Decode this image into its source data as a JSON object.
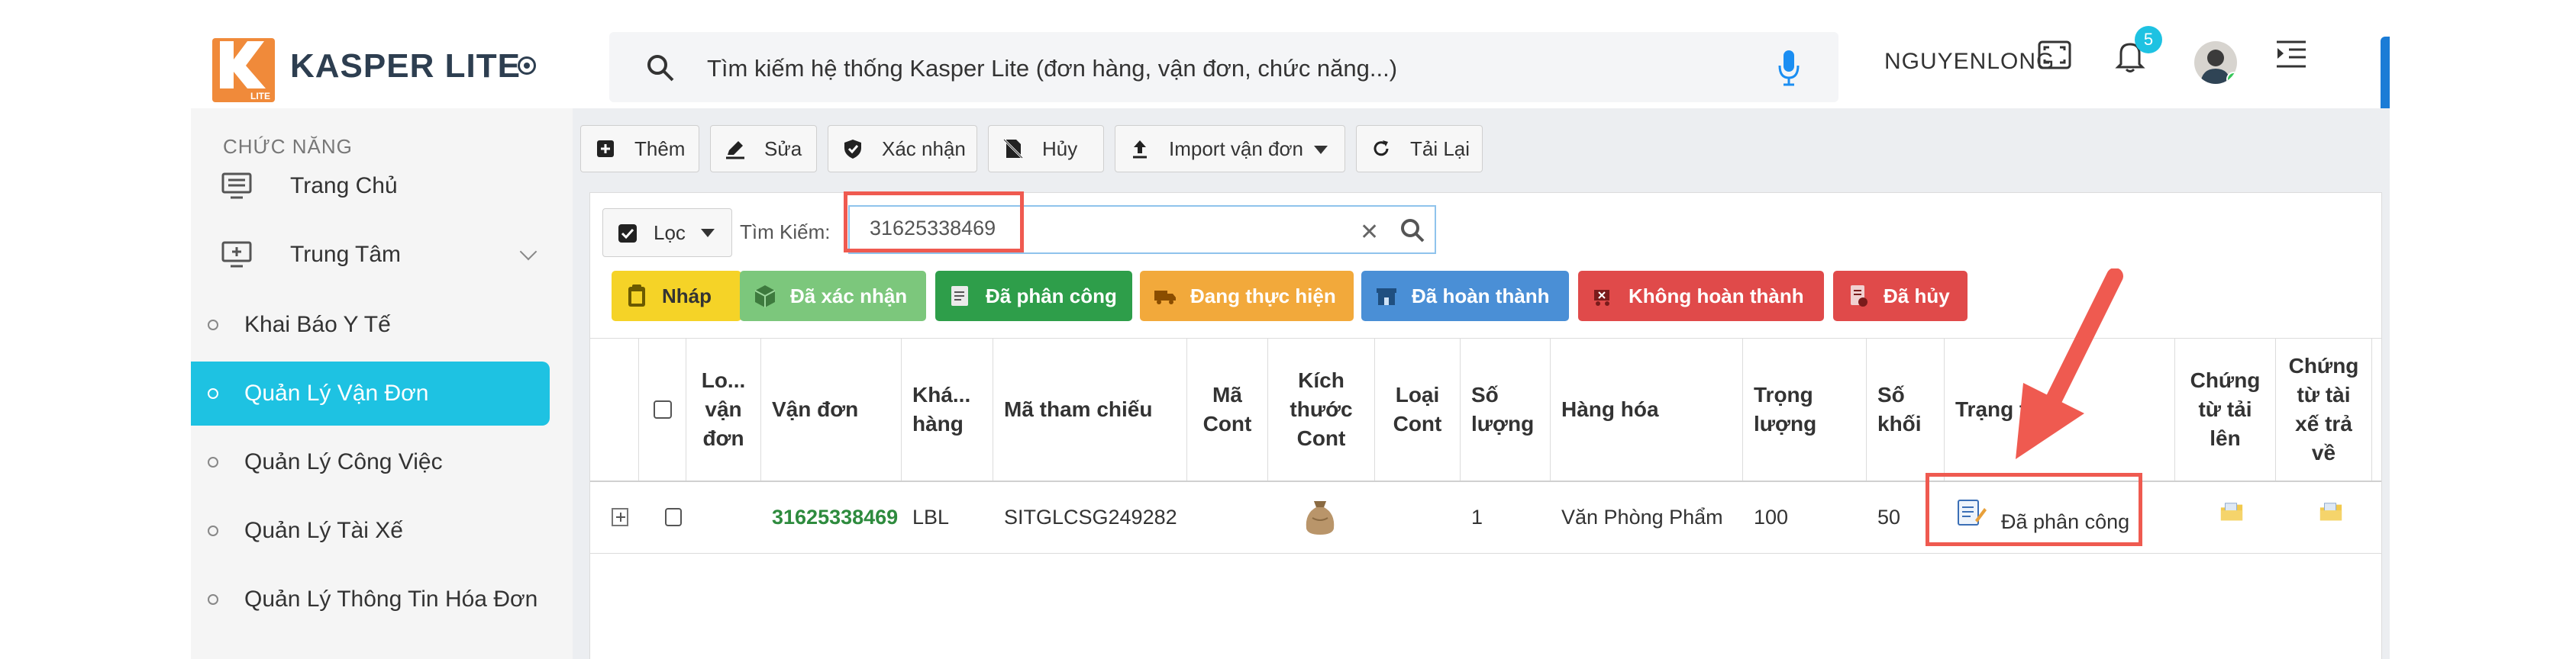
{
  "brand": {
    "name": "KASPER LITE",
    "logo_letter": "K",
    "logo_sub": "LITE"
  },
  "sidebar": {
    "section_title": "CHỨC NĂNG",
    "items": [
      {
        "label": "Trang Chủ",
        "icon": "monitor-icon"
      },
      {
        "label": "Trung Tâm",
        "icon": "add-screen-icon"
      },
      {
        "label": "Khai Báo Y Tế"
      },
      {
        "label": "Quản Lý Vận Đơn",
        "active": true
      },
      {
        "label": "Quản Lý Công Việc"
      },
      {
        "label": "Quản Lý Tài Xế"
      },
      {
        "label": "Quản Lý Thông Tin Hóa Đơn"
      }
    ]
  },
  "topbar": {
    "search_text": "Tìm kiếm hệ thống Kasper Lite (đơn hàng, vận đơn, chức năng...)",
    "username": "NGUYENLONG",
    "notification_count": "5"
  },
  "toolbar": {
    "add": "Thêm",
    "edit": "Sửa",
    "confirm": "Xác nhận",
    "cancel": "Hủy",
    "import": "Import vận đơn",
    "reload": "Tải Lại"
  },
  "filter": {
    "filter_label": "Lọc",
    "search_label": "Tìm Kiếm:",
    "search_value": "31625338469"
  },
  "status_chips": [
    {
      "label": "Nháp",
      "color": "#f5d327",
      "text_color": "#333333"
    },
    {
      "label": "Đã xác nhận",
      "color": "#7cc77c",
      "text_color": "#ffffff"
    },
    {
      "label": "Đã phân công",
      "color": "#2e9e4a",
      "text_color": "#ffffff"
    },
    {
      "label": "Đang thực hiện",
      "color": "#f2a93b",
      "text_color": "#ffffff"
    },
    {
      "label": "Đã hoàn thành",
      "color": "#4a8fd6",
      "text_color": "#ffffff"
    },
    {
      "label": "Không hoàn thành",
      "color": "#e04a4a",
      "text_color": "#ffffff"
    },
    {
      "label": "Đã hủy",
      "color": "#e04a4a",
      "text_color": "#ffffff"
    }
  ],
  "table": {
    "headers": {
      "loai_van_don": "Lo... vận đơn",
      "van_don": "Vận đơn",
      "khach_hang": "Khá... hàng",
      "ma_tham_chieu": "Mã tham chiếu",
      "ma_cont": "Mã Cont",
      "kich_thuoc": "Kích thước Cont",
      "loai_cont": "Loại Cont",
      "so_luong": "Số lượng",
      "hang_hoa": "Hàng hóa",
      "trong_luong": "Trọng lượng",
      "so_khoi": "Số khối",
      "trang_thai": "Trạng thá",
      "chung_tu_tai_len": "Chứng từ tải lên",
      "chung_tu_tai_xe": "Chứng từ tài xế trả về"
    },
    "row": {
      "van_don": "31625338469",
      "khach_hang": "LBL",
      "ma_tham_chieu": "SITGLCSG249282",
      "so_luong": "1",
      "hang_hoa": "Văn Phòng Phẩm",
      "trong_luong": "100",
      "so_khoi": "50",
      "trang_thai": "Đã phân công"
    }
  },
  "colors": {
    "accent": "#1ec2e2",
    "highlight": "#ef5a50",
    "link_green": "#2e8b3e"
  }
}
